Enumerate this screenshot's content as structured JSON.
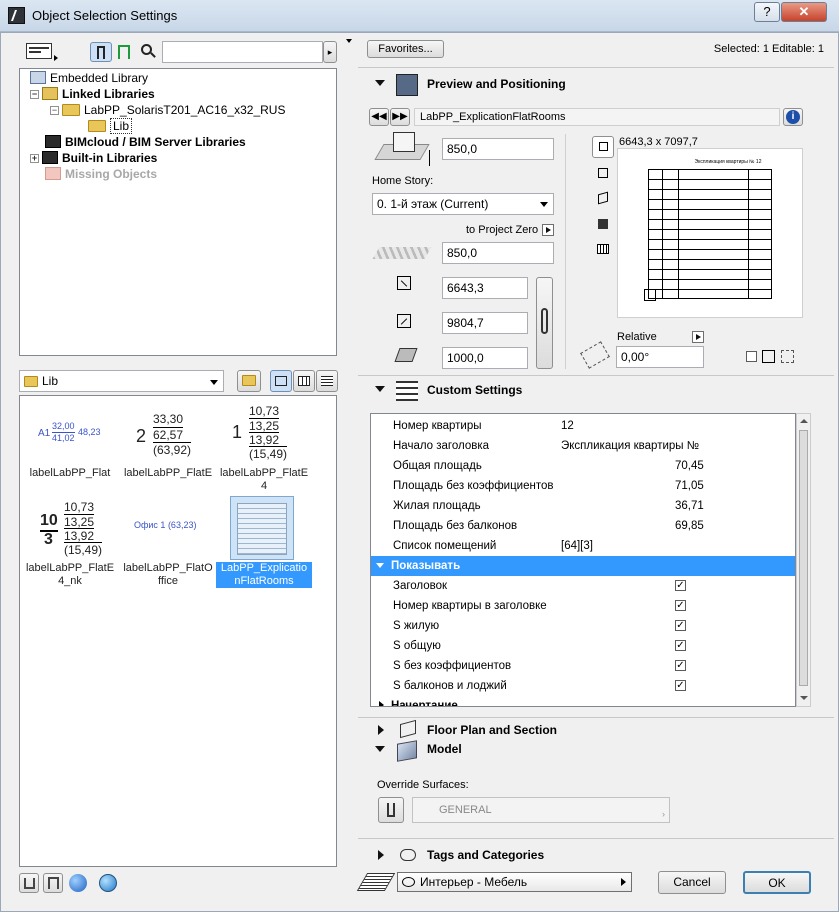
{
  "window": {
    "title": "Object Selection Settings",
    "help": "?",
    "close": "✕"
  },
  "left": {
    "search_placeholder": "",
    "tree": [
      {
        "label": "Embedded Library",
        "bold": false
      },
      {
        "label": "Linked Libraries",
        "bold": true
      },
      {
        "label": "LabPP_SolarisT201_AC16_x32_RUS",
        "bold": false
      },
      {
        "label": "Lib",
        "bold": false
      },
      {
        "label": "BIMcloud / BIM Server Libraries",
        "bold": true
      },
      {
        "label": "Built-in Libraries",
        "bold": true
      },
      {
        "label": "Missing Objects",
        "bold": true
      }
    ],
    "folder_select": "Lib",
    "thumbs": [
      {
        "name": "labelLabPP_Flat",
        "preview": "A1 32,00 41,02 48,23"
      },
      {
        "name": "labelLabPP_FlatE",
        "preview": "2 33,30 62,57 (63,92)"
      },
      {
        "name": "labelLabPP_FlatE4",
        "preview": "1 10,73 13,25 13,92 (15,49)"
      },
      {
        "name": "labelLabPP_FlatE4_nk",
        "preview": "10 3 10,73 13,25 13,92 (15,49)"
      },
      {
        "name": "labelLabPP_FlatOffice",
        "preview": "Офис 1 (63,23)"
      },
      {
        "name": "LabPP_ExplicationFlatRooms",
        "preview": ""
      }
    ],
    "thumb_caps": [
      [
        "labelLabPP_Flat"
      ],
      [
        "labelLabPP_FlatE"
      ],
      [
        "labelLabPP_FlatE",
        "4"
      ],
      [
        "labelLabPP_FlatE",
        "4_nk"
      ],
      [
        "labelLabPP_FlatO",
        "ffice"
      ],
      [
        "LabPP_Explicatio",
        "nFlatRooms"
      ]
    ],
    "preview_texts": {
      "a1": "A1",
      "a1v1": "32,00",
      "a1v2": "41,02",
      "a1v3": "48,23",
      "e_num": "2",
      "e1": "33,30",
      "e2": "62,57",
      "e3": "(63,92)",
      "e4_num": "1",
      "e4_1": "10,73",
      "e4_2": "13,25",
      "e4_3": "13,92",
      "e4_4": "(15,49)",
      "nk_top": "10",
      "nk_bot": "3",
      "nk_1": "10,73",
      "nk_2": "13,25",
      "nk_3": "13,92",
      "nk_4": "(15,49)",
      "office": "Офис 1 (63,23)"
    }
  },
  "right": {
    "favorites": "Favorites...",
    "selected": "Selected: 1 Editable: 1",
    "preview_section": "Preview and Positioning",
    "object_name": "LabPP_ExplicationFlatRooms",
    "height_value": "850,0",
    "home_story_label": "Home Story:",
    "home_story_value": "0. 1-й этаж (Current)",
    "to_project_zero": "to Project Zero",
    "elevation_value": "850,0",
    "width_value": "6643,3",
    "depth_value": "9804,7",
    "height2_value": "1000,0",
    "preview_size": "6643,3 x 7097,7",
    "relative_label": "Relative",
    "angle_value": "0,00°",
    "custom_section": "Custom Settings",
    "params": [
      {
        "name": "Номер квартиры",
        "value": "12",
        "col": "mid"
      },
      {
        "name": "Начало заголовка",
        "value": "Экспликация квартиры №",
        "col": "mid"
      },
      {
        "name": "Общая площадь",
        "value": "70,45",
        "col": "right"
      },
      {
        "name": "Площадь без коэффициентов",
        "value": "71,05",
        "col": "right"
      },
      {
        "name": "Жилая площадь",
        "value": "36,71",
        "col": "right"
      },
      {
        "name": "Площадь без балконов",
        "value": "69,85",
        "col": "right"
      },
      {
        "name": "Список помещений",
        "value": "[64][3]",
        "col": "mid"
      }
    ],
    "group_show": "Показывать",
    "show_params": [
      {
        "name": "Заголовок",
        "checked": true
      },
      {
        "name": "Номер квартиры в заголовке",
        "checked": true
      },
      {
        "name": "S жилую",
        "checked": true
      },
      {
        "name": "S общую",
        "checked": true
      },
      {
        "name": "S без коэффициентов",
        "checked": true
      },
      {
        "name": "S балконов и лоджий",
        "checked": true
      }
    ],
    "group_drawing": "Начертание",
    "floor_plan_section": "Floor Plan and Section",
    "model_section": "Model",
    "override_label": "Override Surfaces:",
    "surface_value": "GENERAL",
    "tags_section": "Tags and Categories",
    "layer_value": "Интерьер - Мебель",
    "cancel": "Cancel",
    "ok": "OK",
    "mini_title": "Экспликация квартиры № 12"
  }
}
